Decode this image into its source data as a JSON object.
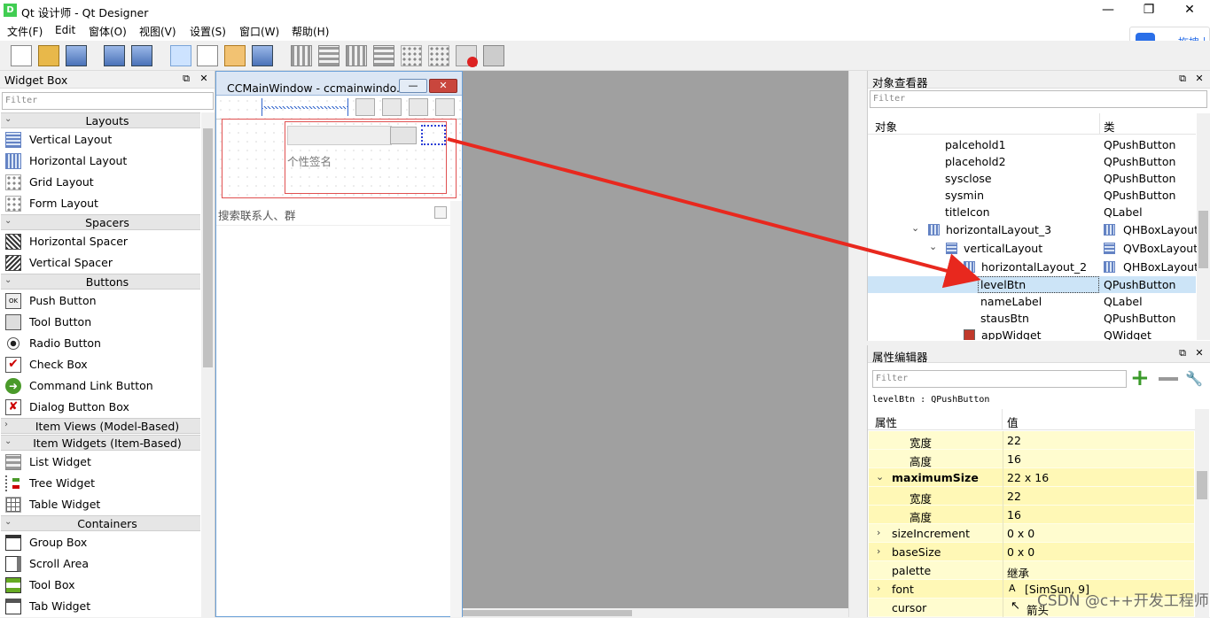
{
  "window": {
    "title": "Qt 设计师 - Qt Designer",
    "icon_letter": "D",
    "minimize": "—",
    "maximize": "❐",
    "close": "✕"
  },
  "menu": [
    "文件(F)",
    "Edit",
    "窗体(O)",
    "视图(V)",
    "设置(S)",
    "窗口(W)",
    "帮助(H)"
  ],
  "drag_button": {
    "label": "拖拽上"
  },
  "widget_box": {
    "title": "Widget Box",
    "filter_placeholder": "Filter",
    "categories": {
      "layouts": "Layouts",
      "spacers": "Spacers",
      "buttons": "Buttons",
      "item_views": "Item Views (Model-Based)",
      "item_widgets": "Item Widgets (Item-Based)",
      "containers": "Containers"
    },
    "items": {
      "vertical_layout": "Vertical Layout",
      "horizontal_layout": "Horizontal Layout",
      "grid_layout": "Grid Layout",
      "form_layout": "Form Layout",
      "horizontal_spacer": "Horizontal Spacer",
      "vertical_spacer": "Vertical Spacer",
      "push_button": "Push Button",
      "tool_button": "Tool Button",
      "radio_button": "Radio Button",
      "check_box": "Check Box",
      "command_link_button": "Command Link Button",
      "dialog_button_box": "Dialog Button Box",
      "list_widget": "List Widget",
      "tree_widget": "Tree Widget",
      "table_widget": "Table Widget",
      "group_box": "Group Box",
      "scroll_area": "Scroll Area",
      "tool_box": "Tool Box",
      "tab_widget": "Tab Widget"
    }
  },
  "form": {
    "title": "CCMainWindow - ccmainwindo...",
    "signature_placeholder": "个性签名",
    "search_placeholder": "搜索联系人、群"
  },
  "object_inspector": {
    "title": "对象查看器",
    "filter_placeholder": "Filter",
    "col_object": "对象",
    "col_class": "类",
    "rows": [
      {
        "name": "palcehold1",
        "class": "QPushButton"
      },
      {
        "name": "placehold2",
        "class": "QPushButton"
      },
      {
        "name": "sysclose",
        "class": "QPushButton"
      },
      {
        "name": "sysmin",
        "class": "QPushButton"
      },
      {
        "name": "titleIcon",
        "class": "QLabel"
      },
      {
        "name": "horizontalLayout_3",
        "class": "QHBoxLayout"
      },
      {
        "name": "verticalLayout",
        "class": "QVBoxLayout"
      },
      {
        "name": "horizontalLayout_2",
        "class": "QHBoxLayout"
      },
      {
        "name": "levelBtn",
        "class": "QPushButton"
      },
      {
        "name": "nameLabel",
        "class": "QLabel"
      },
      {
        "name": "stausBtn",
        "class": "QPushButton"
      },
      {
        "name": "appWidget",
        "class": "QWidget"
      }
    ]
  },
  "property_editor": {
    "title": "属性编辑器",
    "filter_placeholder": "Filter",
    "object_line": "levelBtn : QPushButton",
    "col_property": "属性",
    "col_value": "值",
    "rows": [
      {
        "name": "宽度",
        "value": "22"
      },
      {
        "name": "高度",
        "value": "16"
      },
      {
        "name": "maximumSize",
        "value": "22 x 16"
      },
      {
        "name": "宽度",
        "value": "22"
      },
      {
        "name": "高度",
        "value": "16"
      },
      {
        "name": "sizeIncrement",
        "value": "0 x 0"
      },
      {
        "name": "baseSize",
        "value": "0 x 0"
      },
      {
        "name": "palette",
        "value": "继承"
      },
      {
        "name": "font",
        "value": "[SimSun, 9]"
      },
      {
        "name": "cursor",
        "value": "箭头"
      }
    ]
  },
  "watermark": "CSDN @c++开发工程师",
  "colors": {
    "accent_red": "#e8281e",
    "selection": "#cce4f7",
    "prop_bg": "#fffccf"
  }
}
